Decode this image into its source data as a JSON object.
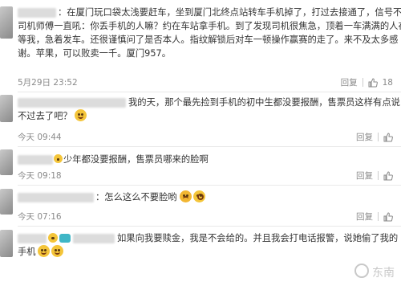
{
  "comments": [
    {
      "text_lines": [
        "：在厦门玩口袋太浅要赶车，坐到厦门北终点站转车手机掉了，打过去接通了，信号不好",
        "司机师傅一直吼：你丢手机的人嘛？约在车站拿手机。到了发现司机很焦急，顶着一车满满的人在",
        "等我，急着发车。还很谨慎问了是否本人。指纹解锁后对车一顿操作赢赛的走了。来不及太多感",
        "谢。苹果，可以败卖一千。厦门957。"
      ],
      "time": "5月29日 23:52",
      "reply_label": "回复",
      "likes": "18"
    },
    {
      "text_lines": [
        "我的天，那个最先捡到手机的初中生都没要报酬，售票员这样有点说",
        "不过去了吧？"
      ],
      "time": "今天 09:44",
      "reply_label": "回复",
      "likes": ""
    },
    {
      "text_lines": [
        "少年都没要报酬，售票员哪来的脸啊"
      ],
      "time": "今天 09:18",
      "reply_label": "回复",
      "likes": ""
    },
    {
      "text_lines": [
        "：怎么这么不要脸哟"
      ],
      "time": "今天 07:16",
      "reply_label": "回复",
      "likes": ""
    },
    {
      "text_lines": [
        "如果向我要赎金，我是不会给的。并且我会打电话报警，说她偷了我的",
        "手机"
      ],
      "time": "",
      "reply_label": "",
      "likes": ""
    }
  ],
  "watermark": "东南"
}
